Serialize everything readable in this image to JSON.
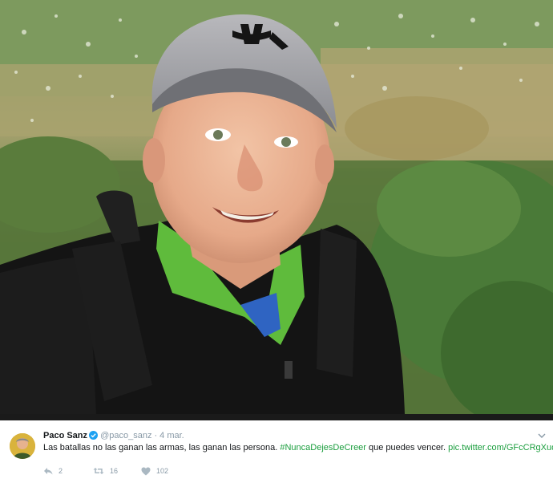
{
  "tweet": {
    "author_name": "Paco Sanz",
    "author_handle": "@paco_sanz",
    "separator": "·",
    "timestamp": "4 mar.",
    "text_part1": "Las batallas no las ganan las armas, las ganan las persona. ",
    "hashtag": "#NuncaDejesDeCreer",
    "text_part2": " que puedes vencer. ",
    "pic_link": "pic.twitter.com/GFcCRgXuqf",
    "replies": "2",
    "retweets": "16",
    "likes": "102"
  },
  "colors": {
    "link": "#1b9e3e",
    "verified": "#1da1f2",
    "muted": "#8899a6",
    "text": "#14171a"
  },
  "icons": {
    "verified": "verified-badge-icon",
    "more": "chevron-down-icon",
    "reply": "reply-icon",
    "retweet": "retweet-icon",
    "like": "heart-icon"
  }
}
